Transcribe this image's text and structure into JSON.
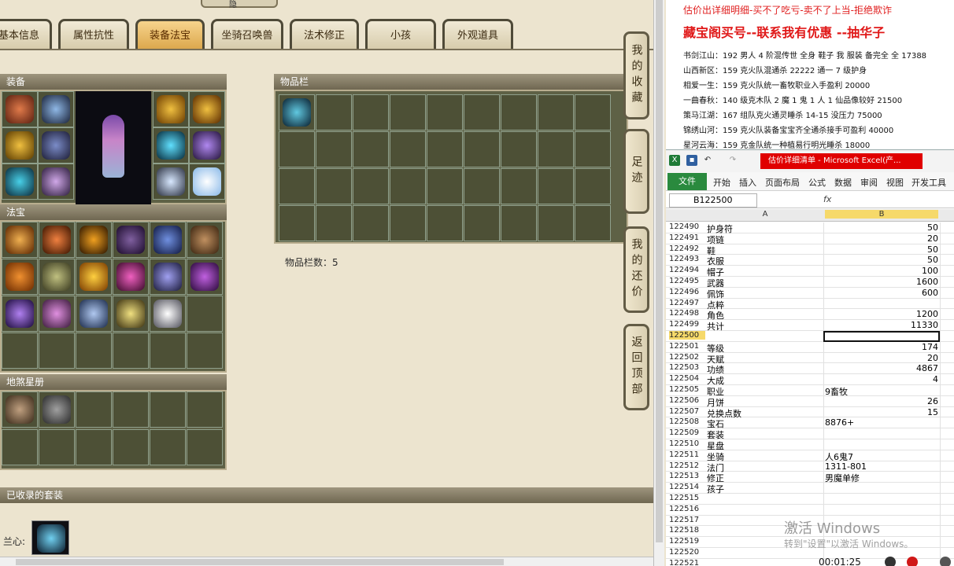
{
  "game": {
    "top_label": "隐",
    "tabs": [
      {
        "label": "基本信息"
      },
      {
        "label": "属性抗性"
      },
      {
        "label": "装备法宝",
        "active": true
      },
      {
        "label": "坐骑召唤兽"
      },
      {
        "label": "法术修正"
      },
      {
        "label": "小孩"
      },
      {
        "label": "外观道具"
      }
    ],
    "side_buttons": [
      "我的收藏",
      "足迹",
      "我的还价",
      "返回顶部"
    ],
    "sections": {
      "equipment": "装备",
      "inventory": "物品栏",
      "fabao": "法宝",
      "dishaxingce": "地煞星册",
      "collected": "已收录的套装"
    },
    "inventory_count": "物品栏数：5",
    "collected_item_label": "兰心:"
  },
  "note": {
    "red_line": "估价出详细明细-买不了吃亏-卖不了上当-拒绝欺诈",
    "headline": "藏宝阁买号--联系我有优惠 --抽华子",
    "lines": [
      "书剑江山：192 男人 4 阶混传世 全身 鞋子 我 服装 备完全 全 17388",
      "山西新区：159 克火队混通杀 22222 通一 7 级护身",
      "相爱一生：159 克火队统一畜牧职业入手盈利 20000",
      "一曲春秋：140 级克木队 2 魔 1 鬼 1 人 1 仙品像较好 21500",
      "策马江湖：167 组队克火通灵睡杀 14-15 没压力 75000",
      "锦绣山河：159 克火队装备宝宝齐全通杀接手可盈利 40000",
      "星河云海：159 克金队统一种植易行明光睡杀 18000"
    ]
  },
  "excel": {
    "window_title": "估价详细清单 - Microsoft Excel(产...",
    "ribbon_file": "文件",
    "ribbon_tabs": [
      "开始",
      "插入",
      "页面布局",
      "公式",
      "数据",
      "审阅",
      "视图",
      "开发工具"
    ],
    "name_box": "B122500",
    "fx": "fx",
    "col_a": "A",
    "col_b": "B",
    "rows": [
      {
        "n": "122490",
        "a": "护身符",
        "b": "50",
        "num": true
      },
      {
        "n": "122491",
        "a": "项链",
        "b": "20",
        "num": true
      },
      {
        "n": "122492",
        "a": "鞋",
        "b": "50",
        "num": true
      },
      {
        "n": "122493",
        "a": "衣服",
        "b": "50",
        "num": true
      },
      {
        "n": "122494",
        "a": "帽子",
        "b": "100",
        "num": true
      },
      {
        "n": "122495",
        "a": "武器",
        "b": "1600",
        "num": true
      },
      {
        "n": "122496",
        "a": "佩饰",
        "b": "600",
        "num": true
      },
      {
        "n": "122497",
        "a": "点粹",
        "b": "",
        "num": true
      },
      {
        "n": "122498",
        "a": "角色",
        "b": "1200",
        "num": true
      },
      {
        "n": "122499",
        "a": "共计",
        "b": "11330",
        "num": true
      },
      {
        "n": "122500",
        "a": "",
        "b": "",
        "num": true,
        "selected": true
      },
      {
        "n": "122501",
        "a": "等级",
        "b": "174",
        "num": true
      },
      {
        "n": "122502",
        "a": "天赋",
        "b": "20",
        "num": true
      },
      {
        "n": "122503",
        "a": "功绩",
        "b": "4867",
        "num": true
      },
      {
        "n": "122504",
        "a": "大成",
        "b": "4",
        "num": true
      },
      {
        "n": "122505",
        "a": "职业",
        "b": "9畜牧",
        "num": false
      },
      {
        "n": "122506",
        "a": "月饼",
        "b": "26",
        "num": true
      },
      {
        "n": "122507",
        "a": "兑换点数",
        "b": "15",
        "num": true
      },
      {
        "n": "122508",
        "a": "宝石",
        "b": "8876+",
        "num": false
      },
      {
        "n": "122509",
        "a": "套装",
        "b": "",
        "num": false
      },
      {
        "n": "122510",
        "a": "星盘",
        "b": "",
        "num": false
      },
      {
        "n": "122511",
        "a": "坐骑",
        "b": "人6鬼7",
        "num": false
      },
      {
        "n": "122512",
        "a": "法门",
        "b": "1311-801",
        "num": false
      },
      {
        "n": "122513",
        "a": "修正",
        "b": "男魔单修",
        "num": false
      },
      {
        "n": "122514",
        "a": "孩子",
        "b": "",
        "num": false
      },
      {
        "n": "122515",
        "a": "",
        "b": "",
        "num": false
      },
      {
        "n": "122516",
        "a": "",
        "b": "",
        "num": false
      },
      {
        "n": "122517",
        "a": "",
        "b": "",
        "num": false
      },
      {
        "n": "122518",
        "a": "",
        "b": "",
        "num": false
      },
      {
        "n": "122519",
        "a": "",
        "b": "",
        "num": false
      },
      {
        "n": "122520",
        "a": "",
        "b": "",
        "num": false
      },
      {
        "n": "122521",
        "a": "",
        "b": "",
        "num": false
      }
    ]
  },
  "overlay": {
    "activate_title": "激活 Windows",
    "activate_sub": "转到\"设置\"以激活 Windows。",
    "timer": "00:01:25"
  },
  "colors": {
    "accent_red": "#e02020",
    "excel_green": "#2a8a3e",
    "selected_row": "#f6d96a"
  }
}
